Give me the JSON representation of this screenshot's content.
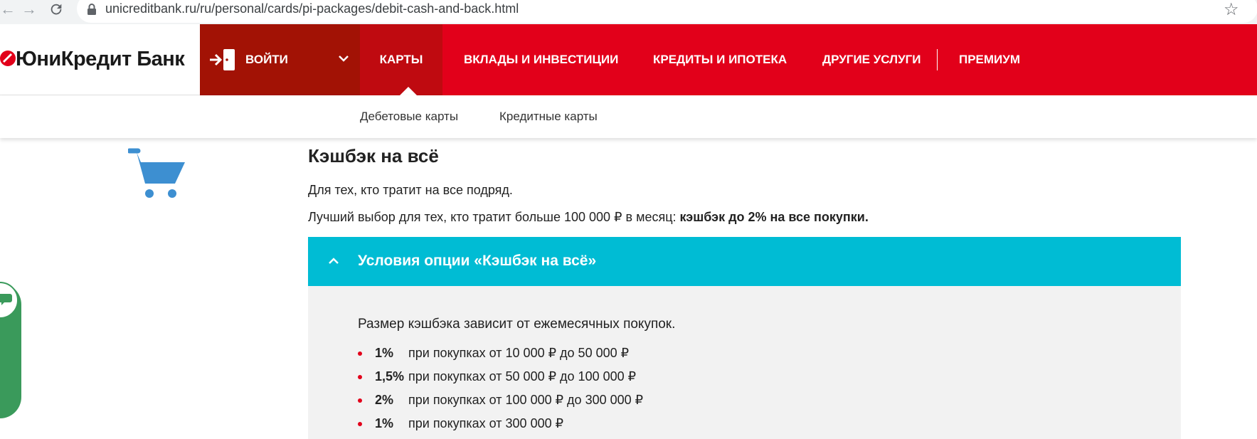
{
  "browser": {
    "url": "unicreditbank.ru/ru/personal/cards/pi-packages/debit-cash-and-back.html"
  },
  "header": {
    "logo_text": "ЮниКредит Банк",
    "login_label": "ВОЙТИ",
    "menu": [
      {
        "label": "КАРТЫ",
        "active": true
      },
      {
        "label": "ВКЛАДЫ И ИНВЕСТИЦИИ"
      },
      {
        "label": "КРЕДИТЫ И ИПОТЕКА"
      },
      {
        "label": "ДРУГИЕ УСЛУГИ"
      },
      {
        "label": "ПРЕМИУМ"
      }
    ]
  },
  "subnav": {
    "items": [
      "Дебетовые карты",
      "Кредитные карты"
    ]
  },
  "content": {
    "title": "Кэшбэк на всё",
    "subtitle": "Для тех, кто тратит на все подряд.",
    "lead_normal": "Лучший выбор для тех, кто тратит больше 100 000 ₽ в месяц: ",
    "lead_bold": "кэшбэк до 2% на все покупки."
  },
  "accordion": {
    "title": "Условия опции «Кэшбэк на всё»",
    "intro": "Размер кэшбэка зависит от ежемесячных покупок.",
    "tiers": [
      {
        "rate": "1%",
        "desc": "при покупках от 10 000 ₽ до 50 000 ₽"
      },
      {
        "rate": "1,5%",
        "desc": "при покупках от 50 000 ₽ до 100 000 ₽"
      },
      {
        "rate": "2%",
        "desc": "при покупках от 100 000 ₽ до 300 000 ₽"
      },
      {
        "rate": "1%",
        "desc": "при покупках от 300 000 ₽"
      }
    ]
  },
  "colors": {
    "brand_red": "#e2001a",
    "login_dark_red": "#a21205",
    "accordion_cyan": "#00bcd4",
    "cart_blue": "#3d8fd1",
    "feedback_green": "#3a9a5b"
  },
  "icons": [
    "back-arrow-icon",
    "forward-arrow-icon",
    "reload-icon",
    "lock-icon",
    "star-icon",
    "unicredit-logo-icon",
    "login-door-icon",
    "chevron-down-icon",
    "cart-icon",
    "chevron-up-icon",
    "chat-icon"
  ]
}
